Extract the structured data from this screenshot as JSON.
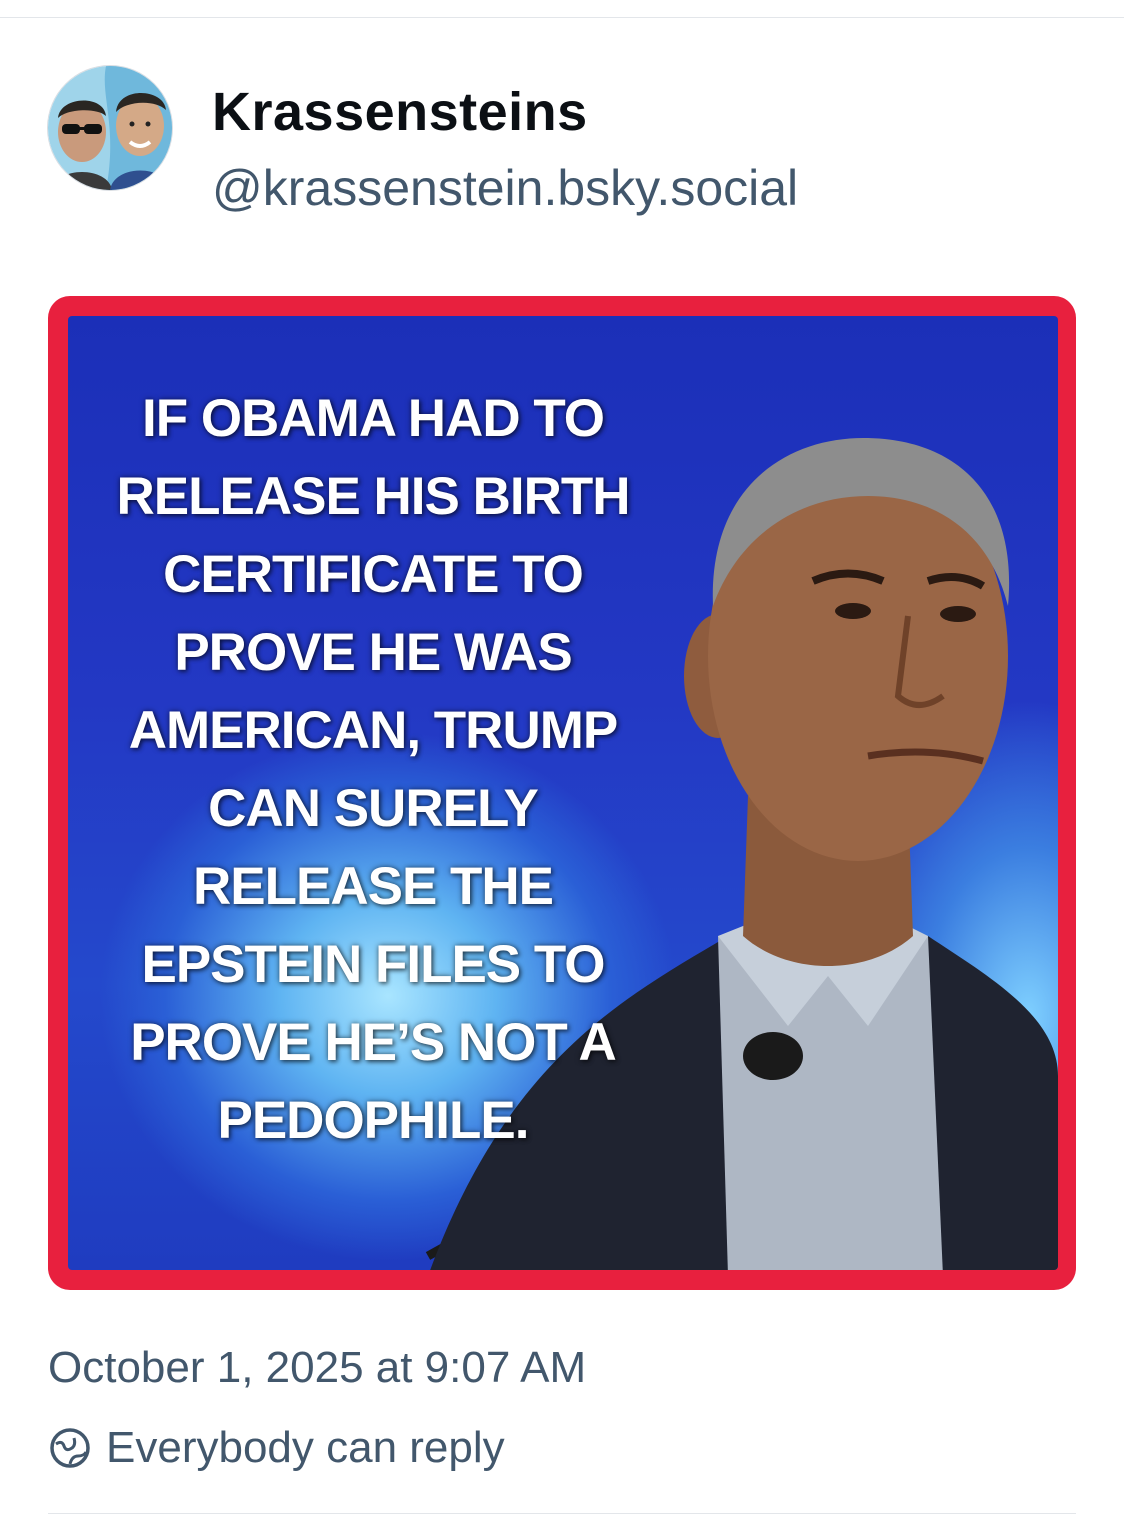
{
  "author": {
    "display_name": "Krassensteins",
    "handle": "@krassenstein.bsky.social",
    "avatar_icon": "avatar-two-men-icon"
  },
  "post": {
    "image": {
      "text_lines": [
        "IF OBAMA HAD TO",
        "RELEASE HIS BIRTH",
        "CERTIFICATE TO",
        "PROVE HE WAS",
        "AMERICAN, TRUMP",
        "CAN SURELY",
        "RELEASE THE",
        "EPSTEIN FILES TO",
        "PROVE HE’S NOT A",
        "PEDOPHILE."
      ],
      "border_color": "#e8203e",
      "background_color": "#2338c4"
    },
    "timestamp": "October 1, 2025 at 9:07 AM",
    "reply_setting": "Everybody can reply",
    "reply_icon": "globe-icon"
  },
  "colors": {
    "text_primary": "#0b0f14",
    "text_secondary": "#42576c",
    "divider": "#e3e6ea"
  }
}
